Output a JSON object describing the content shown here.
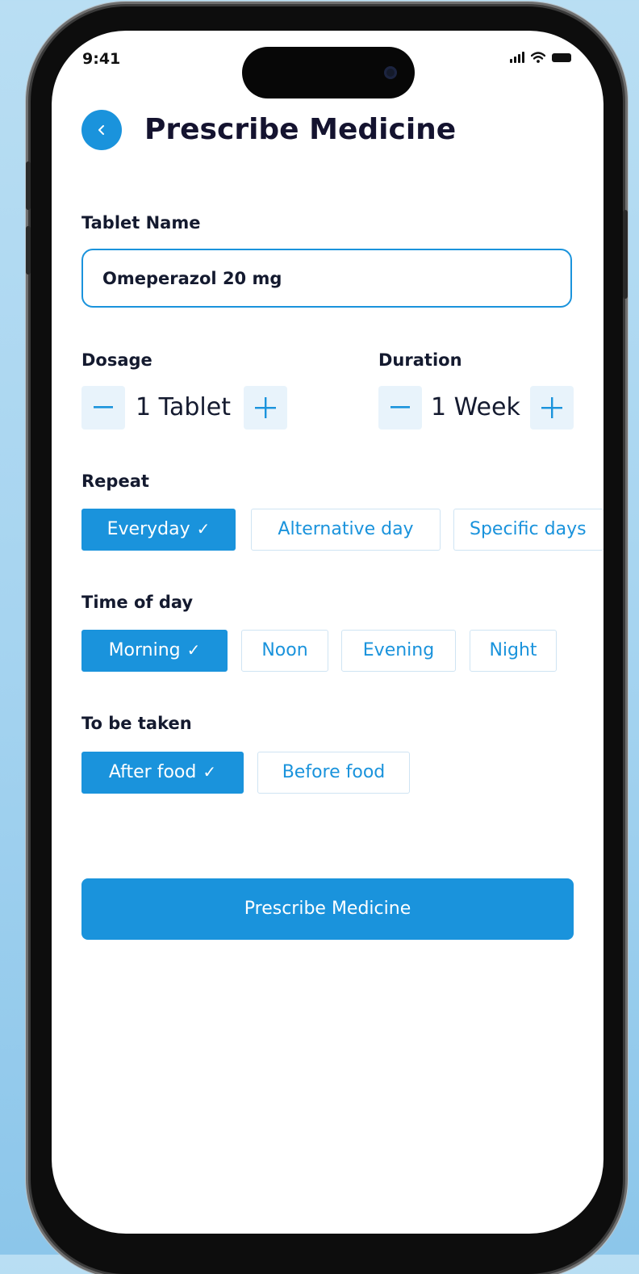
{
  "status_bar": {
    "time": "9:41"
  },
  "header": {
    "title": "Prescribe Medicine"
  },
  "form": {
    "tablet_name": {
      "label": "Tablet Name",
      "value": "Omeperazol 20 mg"
    },
    "dosage": {
      "label": "Dosage",
      "value": "1 Tablet",
      "decrement": "—",
      "increment": "+"
    },
    "duration": {
      "label": "Duration",
      "value": "1 Week",
      "decrement": "—",
      "increment": "+"
    },
    "repeat": {
      "label": "Repeat",
      "options": [
        {
          "label": "Everyday",
          "selected": true
        },
        {
          "label": "Alternative day",
          "selected": false
        },
        {
          "label": "Specific days",
          "selected": false
        }
      ]
    },
    "time_of_day": {
      "label": "Time of day",
      "options": [
        {
          "label": "Morning",
          "selected": true
        },
        {
          "label": "Noon",
          "selected": false
        },
        {
          "label": "Evening",
          "selected": false
        },
        {
          "label": "Night",
          "selected": false
        }
      ]
    },
    "to_be_taken": {
      "label": "To be taken",
      "options": [
        {
          "label": "After food",
          "selected": true
        },
        {
          "label": "Before food",
          "selected": false
        }
      ]
    },
    "check_mark": "✓"
  },
  "submit_button": {
    "label": "Prescribe Medicine"
  },
  "colors": {
    "accent": "#1a93dc",
    "title_text": "#14132f",
    "stepper_bg": "#e8f3fb",
    "chip_border": "#cfe4f3",
    "background_gradient": [
      "#b9def3",
      "#8cc6ea"
    ]
  },
  "icons": [
    "back-arrow-icon",
    "signal-icon",
    "wifi-icon",
    "battery-icon",
    "check-icon",
    "minus-icon",
    "plus-icon"
  ]
}
